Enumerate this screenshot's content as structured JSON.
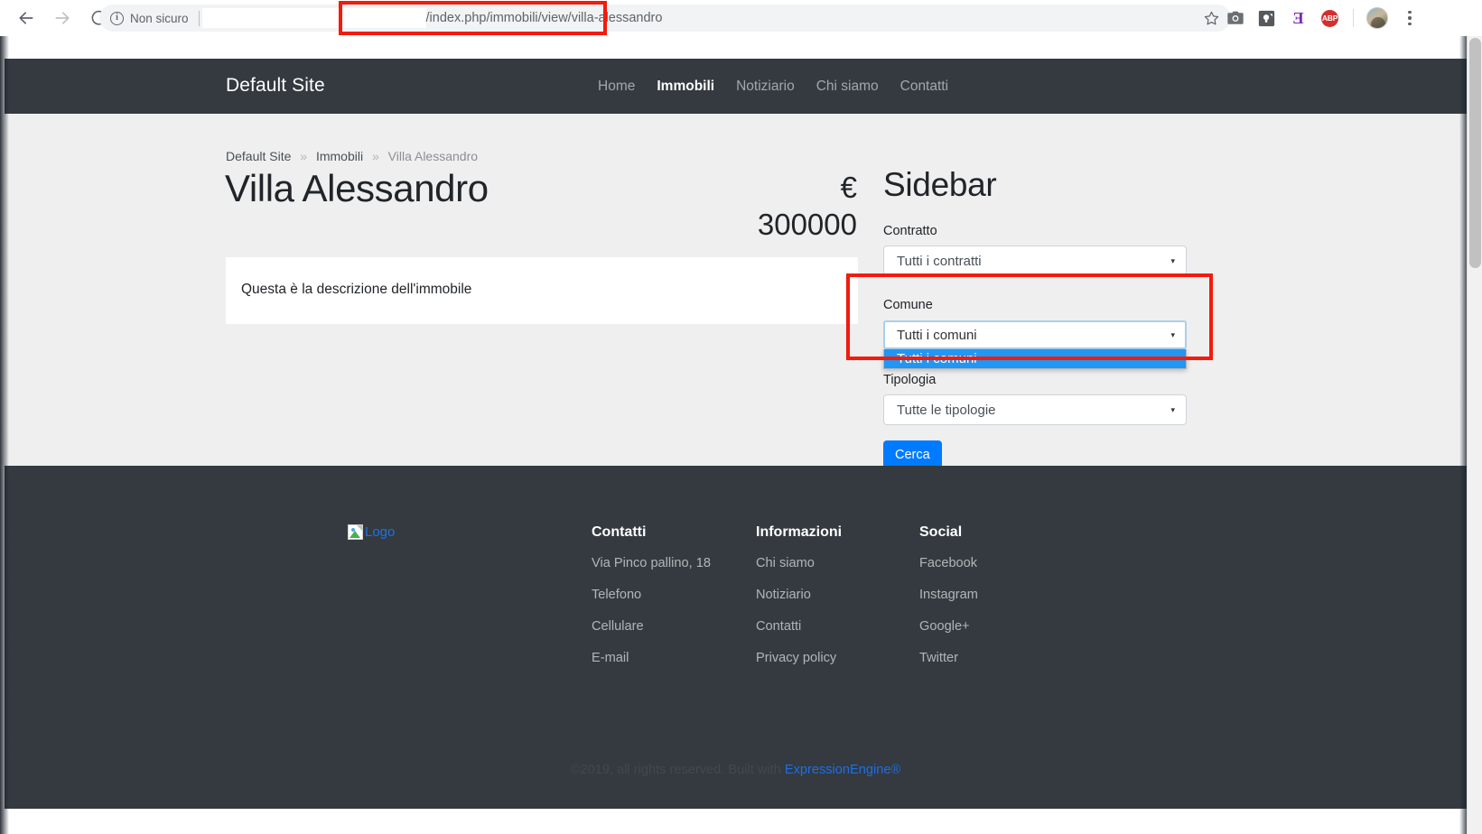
{
  "browser": {
    "back_icon": "arrow-left-icon",
    "forward_icon": "arrow-right-icon",
    "reload_icon": "reload-icon",
    "security_label": "Non sicuro",
    "info_glyph": "i",
    "url_visible_text": "/index.php/immobili/view/villa-alessandro",
    "url_redacted": true,
    "bookmark_icon": "star-icon",
    "extensions": [
      {
        "name": "screenshot-camera-icon",
        "glyph": "camera"
      },
      {
        "name": "notes-lightbulb-icon",
        "glyph": "bulb"
      },
      {
        "name": "evernote-icon",
        "glyph": "E"
      },
      {
        "name": "adblock-plus-icon",
        "glyph": "ABP"
      }
    ],
    "profile_icon": "avatar",
    "menu_icon": "kebab-menu-icon"
  },
  "site": {
    "brand": "Default Site",
    "nav": [
      {
        "label": "Home",
        "active": false
      },
      {
        "label": "Immobili",
        "active": true
      },
      {
        "label": "Notiziario",
        "active": false
      },
      {
        "label": "Chi siamo",
        "active": false
      },
      {
        "label": "Contatti",
        "active": false
      }
    ]
  },
  "breadcrumb": {
    "root": "Default Site",
    "sep": "»",
    "section": "Immobili",
    "current": "Villa Alessandro"
  },
  "listing": {
    "title": "Villa Alessandro",
    "price_currency": "€",
    "price_amount": "300000",
    "description": "Questa è la descrizione dell'immobile"
  },
  "sidebar": {
    "heading": "Sidebar",
    "contratto": {
      "label": "Contratto",
      "value": "Tutti i contratti",
      "caret": "▾"
    },
    "comune": {
      "label": "Comune",
      "value": "Tutti i comuni",
      "caret": "▾",
      "open": true,
      "options": [
        {
          "label": "Tutti i comuni",
          "selected": true
        }
      ]
    },
    "tipologia": {
      "label": "Tipologia",
      "value": "Tutte le tipologie",
      "caret": "▾"
    },
    "search_button": "Cerca"
  },
  "footer": {
    "logo_alt": "Logo",
    "columns": [
      {
        "heading": "Contatti",
        "items": [
          "Via Pinco pallino, 18",
          "Telefono",
          "Cellulare",
          "E-mail"
        ]
      },
      {
        "heading": "Informazioni",
        "items": [
          "Chi siamo",
          "Notiziario",
          "Contatti",
          "Privacy policy"
        ]
      },
      {
        "heading": "Social",
        "items": [
          "Facebook",
          "Instagram",
          "Google+",
          "Twitter"
        ]
      }
    ],
    "copyright_text": "©2019, all rights reserved. Built with ",
    "copyright_link": "ExpressionEngine®"
  },
  "colors": {
    "header_bg": "#343a40",
    "content_bg": "#efefef",
    "accent_blue": "#007bff",
    "option_highlight": "#2196f3",
    "annotation_red": "#f41a0c",
    "link_blue": "#1f6fe0"
  }
}
